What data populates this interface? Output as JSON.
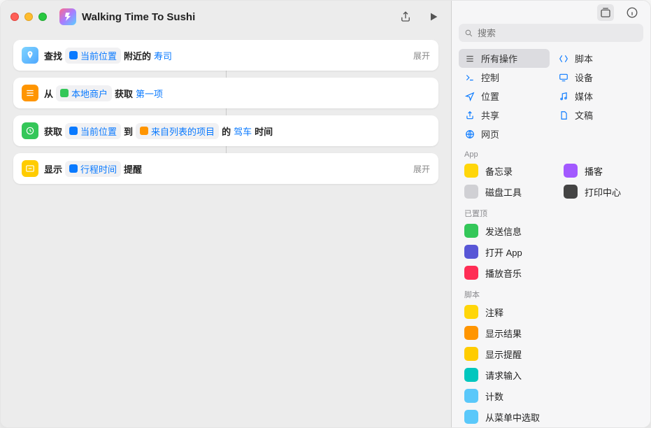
{
  "header": {
    "title": "Walking Time To Sushi"
  },
  "actions": [
    {
      "icon": "maps",
      "iconColor": "linear-gradient(135deg,#7fd4ff,#4fa8ff)",
      "parts": [
        {
          "t": "plain",
          "v": "查找"
        },
        {
          "t": "pill",
          "v": "当前位置",
          "pi": "#0a7aff"
        },
        {
          "t": "plain",
          "v": "附近的"
        },
        {
          "t": "token",
          "v": "寿司"
        }
      ],
      "expand": "展开"
    },
    {
      "icon": "list",
      "iconColor": "#ff9500",
      "parts": [
        {
          "t": "plain",
          "v": "从"
        },
        {
          "t": "pill",
          "v": "本地商户",
          "pi": "#34c759"
        },
        {
          "t": "plain",
          "v": "获取"
        },
        {
          "t": "token",
          "v": "第一项"
        }
      ]
    },
    {
      "icon": "clock",
      "iconColor": "#34c759",
      "parts": [
        {
          "t": "plain",
          "v": "获取"
        },
        {
          "t": "pill",
          "v": "当前位置",
          "pi": "#0a7aff"
        },
        {
          "t": "plain",
          "v": "到"
        },
        {
          "t": "pill",
          "v": "来自列表的项目",
          "pi": "#ff9500"
        },
        {
          "t": "plain",
          "v": "的"
        },
        {
          "t": "token",
          "v": "驾车"
        },
        {
          "t": "plain",
          "v": "时间"
        }
      ]
    },
    {
      "icon": "alert",
      "iconColor": "#ffcc00",
      "parts": [
        {
          "t": "plain",
          "v": "显示"
        },
        {
          "t": "pill",
          "v": "行程时间",
          "pi": "#0a7aff"
        },
        {
          "t": "plain",
          "v": "提醒"
        }
      ],
      "expand": "展开"
    }
  ],
  "search": {
    "placeholder": "搜索"
  },
  "categories": [
    {
      "icon": "list",
      "color": "#8e8e93",
      "label": "所有操作",
      "sel": true
    },
    {
      "icon": "script",
      "color": "#8e8e93",
      "label": "脚本"
    },
    {
      "icon": "control",
      "color": "#8e8e93",
      "label": "控制"
    },
    {
      "icon": "device",
      "color": "#8e8e93",
      "label": "设备"
    },
    {
      "icon": "location",
      "color": "#8e8e93",
      "label": "位置"
    },
    {
      "icon": "media",
      "color": "#8e8e93",
      "label": "媒体"
    },
    {
      "icon": "share",
      "color": "#8e8e93",
      "label": "共享"
    },
    {
      "icon": "doc",
      "color": "#8e8e93",
      "label": "文稿"
    },
    {
      "icon": "web",
      "color": "#8e8e93",
      "label": "网页"
    }
  ],
  "sections": [
    {
      "heading": "App",
      "grid": true,
      "items": [
        {
          "label": "备忘录",
          "color": "#ffd60a"
        },
        {
          "label": "播客",
          "color": "#a259ff"
        },
        {
          "label": "磁盘工具",
          "color": "#d0d0d4"
        },
        {
          "label": "打印中心",
          "color": "#444"
        }
      ]
    },
    {
      "heading": "已置顶",
      "items": [
        {
          "label": "发送信息",
          "color": "#34c759"
        },
        {
          "label": "打开 App",
          "color": "#5856d6"
        },
        {
          "label": "播放音乐",
          "color": "#ff2d55"
        }
      ]
    },
    {
      "heading": "脚本",
      "items": [
        {
          "label": "注释",
          "color": "#ffd60a"
        },
        {
          "label": "显示结果",
          "color": "#ff9500"
        },
        {
          "label": "显示提醒",
          "color": "#ffcc00"
        },
        {
          "label": "请求输入",
          "color": "#00c7be"
        },
        {
          "label": "计数",
          "color": "#5ac8fa"
        },
        {
          "label": "从菜单中选取",
          "color": "#5ac8fa"
        }
      ]
    }
  ]
}
